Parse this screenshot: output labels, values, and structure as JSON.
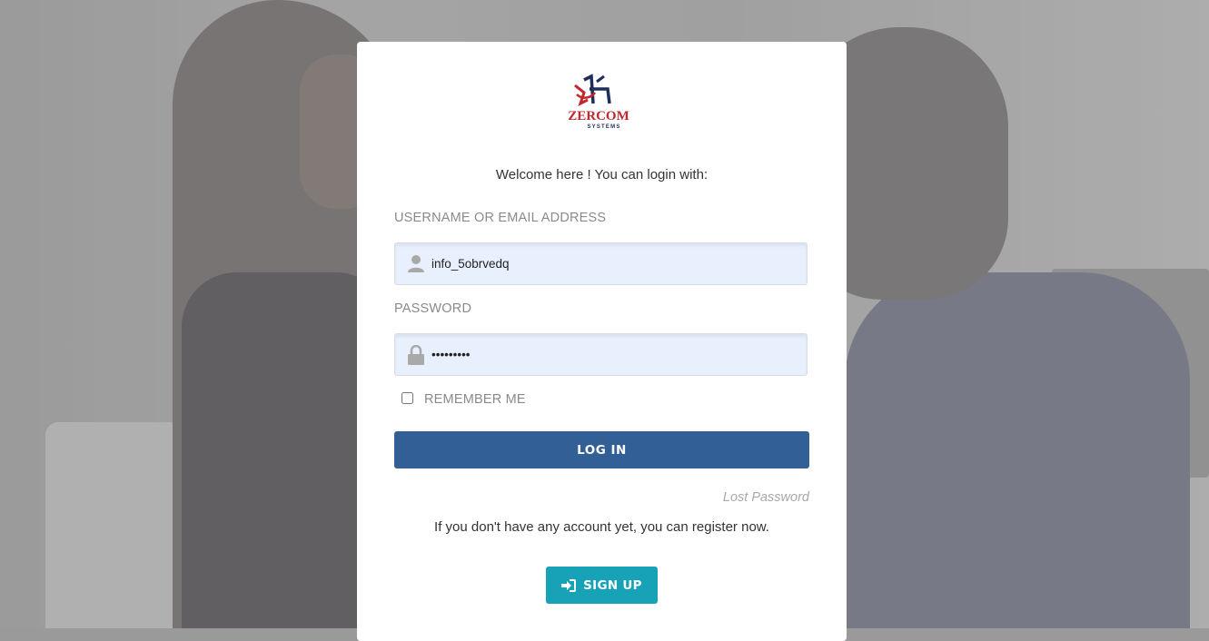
{
  "brand": {
    "logo_text": "ZERCOM",
    "logo_subtext": "SYSTEMS",
    "colors": {
      "red": "#c1272d",
      "navy": "#1f2f5c"
    }
  },
  "login": {
    "welcome_text": "Welcome here ! You can login with:",
    "username_label": "USERNAME OR EMAIL ADDRESS",
    "username_value": "info_5obrvedq",
    "username_icon": "user-icon",
    "password_label": "PASSWORD",
    "password_value": "•••••••••",
    "password_icon": "lock-icon",
    "remember_label": "REMEMBER ME",
    "remember_checked": false,
    "login_button": "LOG IN",
    "lost_password": "Lost Password",
    "register_text": "If you don't have any account yet, you can register now.",
    "signup_button": "SIGN UP",
    "signup_icon": "sign-in-icon"
  },
  "colors": {
    "login_button": "#325f96",
    "signup_button": "#17a2b8",
    "field_bg": "#e8f0fe",
    "label": "#8a8a8a"
  }
}
